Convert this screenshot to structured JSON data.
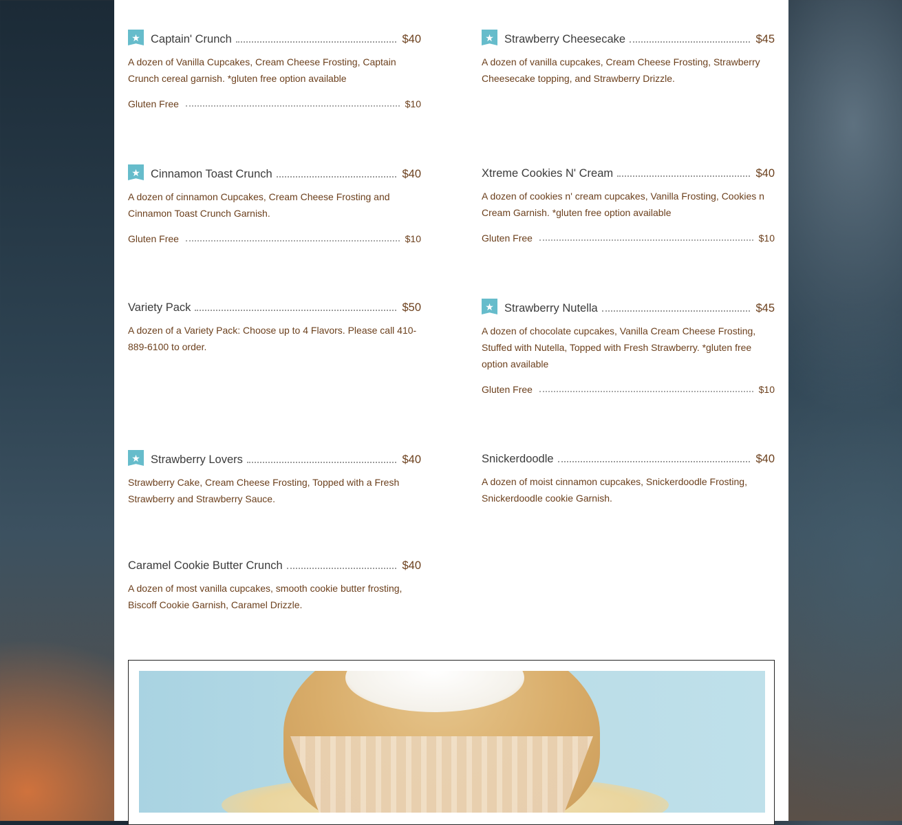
{
  "menu": {
    "left": [
      {
        "name": "Captain' Crunch",
        "price": "$40",
        "featured": true,
        "description": "A dozen of Vanilla Cupcakes, Cream Cheese Frosting, Captain Crunch cereal garnish. *gluten free option available",
        "option": {
          "label": "Gluten Free",
          "price": "$10"
        }
      },
      {
        "name": "Cinnamon Toast Crunch",
        "price": "$40",
        "featured": true,
        "description": "A dozen of cinnamon Cupcakes, Cream Cheese Frosting and Cinnamon Toast Crunch Garnish.",
        "option": {
          "label": "Gluten Free",
          "price": "$10"
        }
      },
      {
        "name": "Variety Pack",
        "price": "$50",
        "featured": false,
        "description": "A dozen of a Variety Pack: Choose up to 4 Flavors. Please call 410-889-6100 to order."
      },
      {
        "name": "Strawberry Lovers",
        "price": "$40",
        "featured": true,
        "description": "Strawberry Cake, Cream Cheese Frosting, Topped with a Fresh Strawberry and Strawberry Sauce."
      },
      {
        "name": "Caramel Cookie Butter Crunch",
        "price": "$40",
        "featured": false,
        "description": "A dozen of most vanilla cupcakes, smooth cookie butter frosting, Biscoff Cookie Garnish, Caramel Drizzle."
      }
    ],
    "right": [
      {
        "name": "Strawberry Cheesecake",
        "price": "$45",
        "featured": true,
        "description": "A dozen of vanilla cupcakes, Cream Cheese Frosting, Strawberry Cheesecake topping, and Strawberry Drizzle."
      },
      {
        "name": "Xtreme Cookies N' Cream",
        "price": "$40",
        "featured": false,
        "description": "A dozen of cookies n' cream cupcakes, Vanilla Frosting, Cookies n Cream Garnish. *gluten free option available",
        "option": {
          "label": "Gluten Free",
          "price": "$10"
        }
      },
      {
        "name": "Strawberry Nutella",
        "price": "$45",
        "featured": true,
        "description": "A dozen of chocolate cupcakes, Vanilla Cream Cheese Frosting, Stuffed with Nutella, Topped with Fresh Strawberry. *gluten free option available",
        "option": {
          "label": "Gluten Free",
          "price": "$10"
        }
      },
      {
        "name": "Snickerdoodle",
        "price": "$40",
        "featured": false,
        "description": "A dozen of moist cinnamon cupcakes, Snickerdoodle Frosting, Snickerdoodle cookie Garnish."
      }
    ]
  },
  "badge_icon": "star-icon",
  "colors": {
    "badge": "#66bccb",
    "price": "#6b3f1c",
    "name": "#3b3b3b"
  }
}
